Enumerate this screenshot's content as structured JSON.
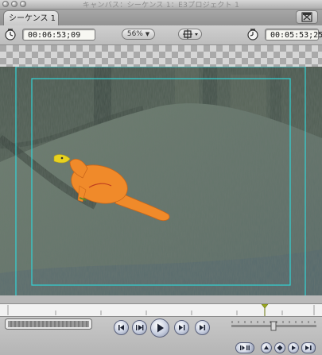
{
  "window": {
    "title": "キャンバス：シーケンス 1：E3プロジェクト 1"
  },
  "tabs": [
    {
      "label": "シーケンス 1",
      "active": true
    }
  ],
  "controls": {
    "duration_timecode": "00:06:53;09",
    "zoom_value": "56%",
    "current_timecode": "00:05:53;25",
    "playhead_position": 0.84
  },
  "colors": {
    "safe_area": "#32d4d6",
    "character": "#f08a2a",
    "playhead": "#9aa81c"
  },
  "icons": {
    "zoom": "dropdown-arrow",
    "view": "crosshair-view",
    "tab_icon": "film-icon"
  }
}
